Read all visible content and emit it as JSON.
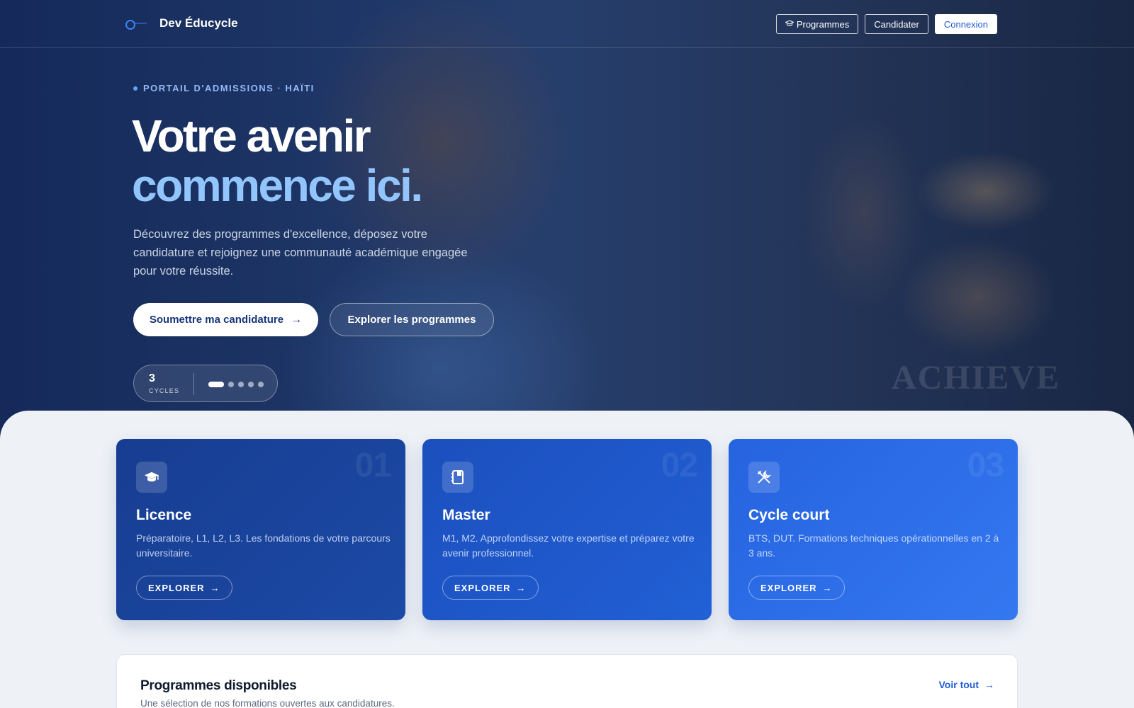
{
  "nav": {
    "brand": "Dev Éducycle",
    "programmes_label": "Programmes",
    "candidater_label": "Candidater",
    "connexion_label": "Connexion"
  },
  "hero": {
    "eyebrow": "PORTAIL D'ADMISSIONS · HAÏTI",
    "title_line1": "Votre avenir",
    "title_line2": "commence ici.",
    "lead": "Découvrez des programmes d'excellence, déposez votre candidature et rejoignez une communauté académique engagée pour votre réussite.",
    "cta_primary": "Soumettre ma candidature",
    "cta_secondary": "Explorer les programmes",
    "stat_value": "3",
    "stat_label": "CYCLES",
    "watermark": "ACHIEVE",
    "carousel_slides": 5,
    "carousel_active_index": 0
  },
  "cards": [
    {
      "number": "01",
      "title": "Licence",
      "description": "Préparatoire, L1, L2, L3. Les fondations de votre parcours universitaire.",
      "button": "EXPLORER",
      "icon": "graduation-cap-icon"
    },
    {
      "number": "02",
      "title": "Master",
      "description": "M1, M2. Approfondissez votre expertise et préparez votre avenir professionnel.",
      "button": "EXPLORER",
      "icon": "book-icon"
    },
    {
      "number": "03",
      "title": "Cycle court",
      "description": "BTS, DUT. Formations techniques opérationnelles en 2 à 3 ans.",
      "button": "EXPLORER",
      "icon": "tools-icon"
    }
  ],
  "programs": {
    "title": "Programmes disponibles",
    "subtitle": "Une sélection de nos formations ouvertes aux candidatures.",
    "link": "Voir tout"
  },
  "colors": {
    "accent": "#1e5bd6",
    "title_highlight": "#93c5fd",
    "card_1": "#173d91",
    "card_2": "#1c4fbd",
    "card_3": "#2663df"
  }
}
